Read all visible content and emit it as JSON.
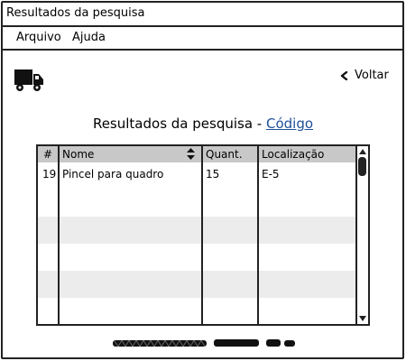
{
  "window": {
    "title": "Resultados da pesquisa"
  },
  "menu": {
    "items": [
      "Arquivo",
      "Ajuda"
    ]
  },
  "toolbar": {
    "logo_icon": "truck-icon",
    "back_icon": "chevron-left-icon",
    "back_label": "Voltar"
  },
  "heading": {
    "prefix": "Resultados da pesquisa - ",
    "link": "Código"
  },
  "table": {
    "columns": [
      "#",
      "Nome",
      "Quant.",
      "Localização"
    ],
    "sort_icon": "sort-updown-icon",
    "rows": [
      {
        "id": "19",
        "nome": "Pincel para quadro",
        "quant": "15",
        "localizacao": "E-5"
      }
    ]
  },
  "colors": {
    "border": "#222222",
    "header_bg": "#c8c8c8",
    "row_alt": "#ececec",
    "link": "#1f4f9a"
  }
}
